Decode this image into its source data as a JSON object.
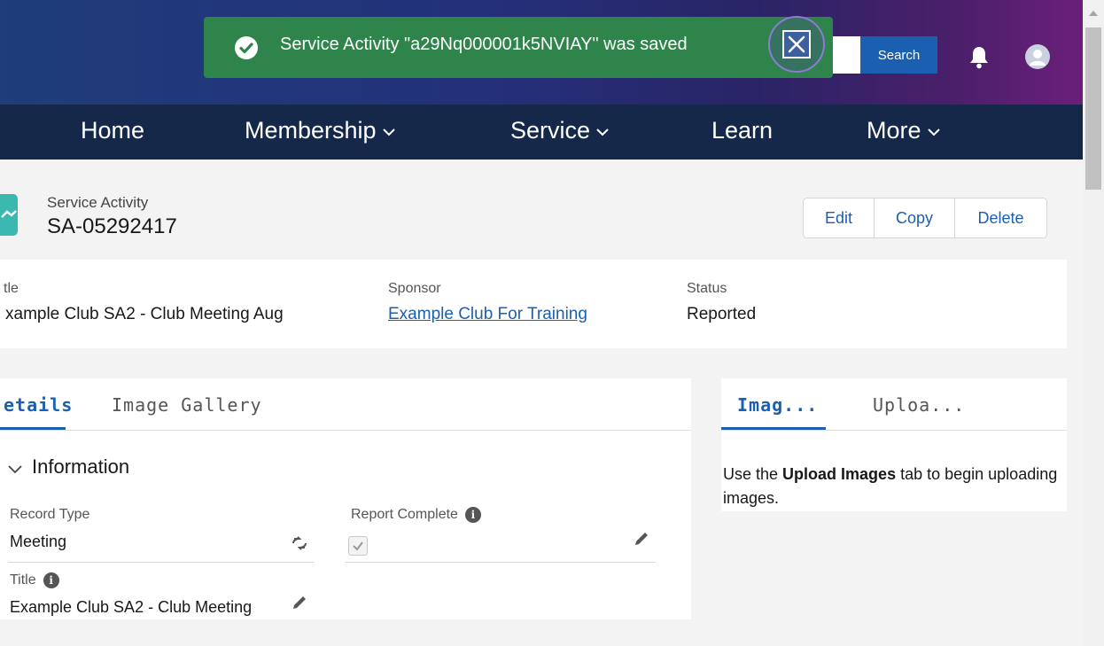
{
  "toast": {
    "message": "Service Activity \"a29Nq000001k5NVIAY\" was saved",
    "icon_left": "success-check-icon",
    "close_icon": "close-icon"
  },
  "header": {
    "search_label": "Search",
    "bell_icon": "notification-bell-icon",
    "avatar_icon": "user-avatar-icon"
  },
  "nav": {
    "items": [
      {
        "label": "Home",
        "has_menu": false
      },
      {
        "label": "Membership",
        "has_menu": true
      },
      {
        "label": "Service",
        "has_menu": true
      },
      {
        "label": "Learn",
        "has_menu": false
      },
      {
        "label": "More",
        "has_menu": true
      }
    ]
  },
  "record": {
    "type_label": "Service Activity",
    "name": "SA-05292417",
    "actions": [
      "Edit",
      "Copy",
      "Delete"
    ]
  },
  "highlights": {
    "fields": [
      {
        "label": "tle",
        "value": "xample Club SA2 - Club Meeting Aug",
        "is_link": false
      },
      {
        "label": "Sponsor",
        "value": "Example Club For Training",
        "is_link": true
      },
      {
        "label": "Status",
        "value": "Reported",
        "is_link": false
      }
    ]
  },
  "details": {
    "tabs": [
      "etails",
      "Image Gallery"
    ],
    "active_tab": 0,
    "section_title": "Information",
    "fields": {
      "record_type_label": "Record Type",
      "record_type_value": "Meeting",
      "report_complete_label": "Report Complete",
      "report_complete_checked": true,
      "title_label": "Title",
      "title_value": "Example Club SA2 - Club Meeting"
    }
  },
  "side_panel": {
    "tabs": [
      "Imag...",
      "Uploa..."
    ],
    "active_tab": 0,
    "text_before": "Use the ",
    "text_bold": "Upload Images",
    "text_after": " tab to begin uploading images."
  },
  "colors": {
    "toast_bg": "#2e844a",
    "nav_bg": "#15284a",
    "brand_blue": "#1b5fb0"
  }
}
